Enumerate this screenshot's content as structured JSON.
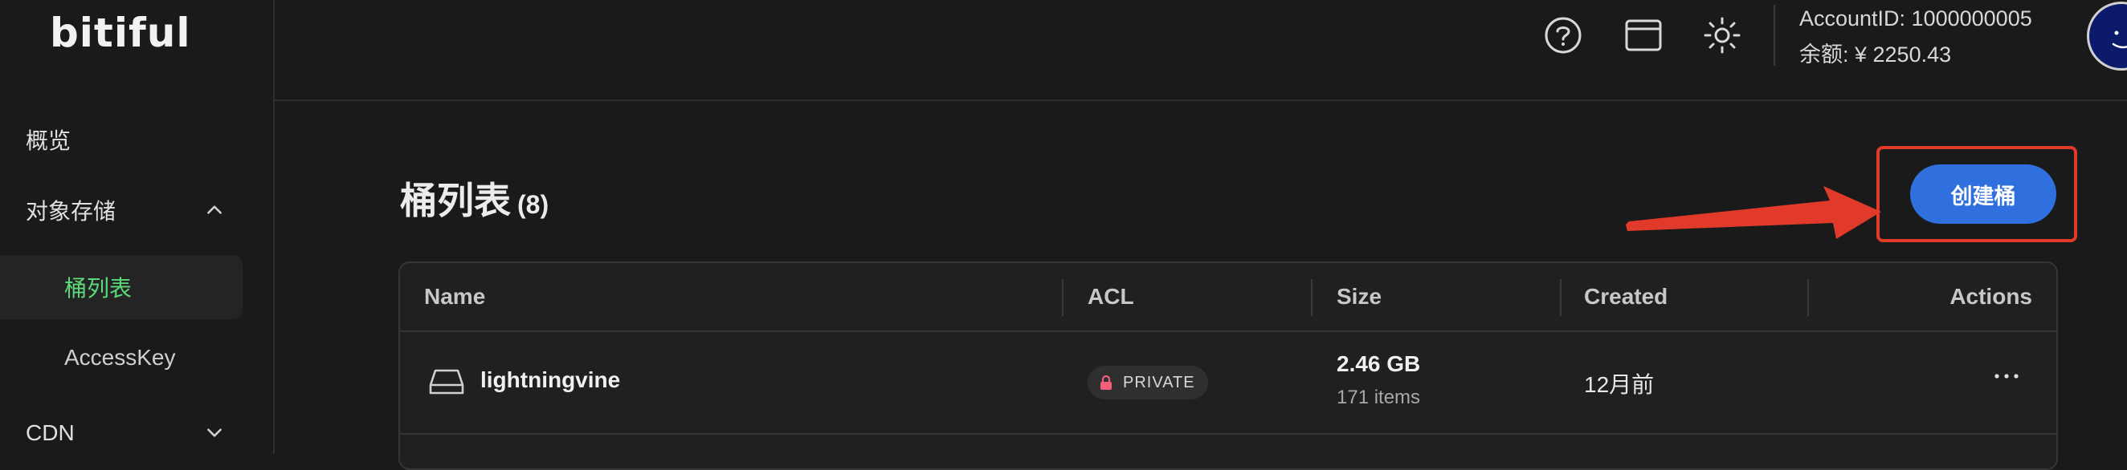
{
  "app": {
    "logo": "bitiful"
  },
  "sidebar": {
    "items": [
      {
        "label": "概览"
      },
      {
        "label": "对象存储"
      },
      {
        "label": "桶列表"
      },
      {
        "label": "AccessKey"
      },
      {
        "label": "CDN"
      }
    ]
  },
  "header": {
    "icons": [
      "help-icon",
      "browser-window-icon",
      "sun-theme-icon"
    ],
    "account_id": "AccountID: 1000000005",
    "balance": "余额: ¥ 2250.43"
  },
  "main": {
    "title": "桶列表",
    "count": "(8)",
    "create_button": "创建桶",
    "table": {
      "columns": [
        "Name",
        "ACL",
        "Size",
        "Created",
        "Actions"
      ],
      "rows": [
        {
          "name": "lightningvine",
          "acl": "PRIVATE",
          "size": "2.46 GB",
          "items": "171 items",
          "created": "12月前",
          "actions": "more-icon"
        }
      ]
    }
  },
  "colors": {
    "accent_green": "#5cd97a",
    "primary_blue": "#2f6fde",
    "annotation_red": "#e23a2a",
    "lock_pink": "#f0607a"
  }
}
